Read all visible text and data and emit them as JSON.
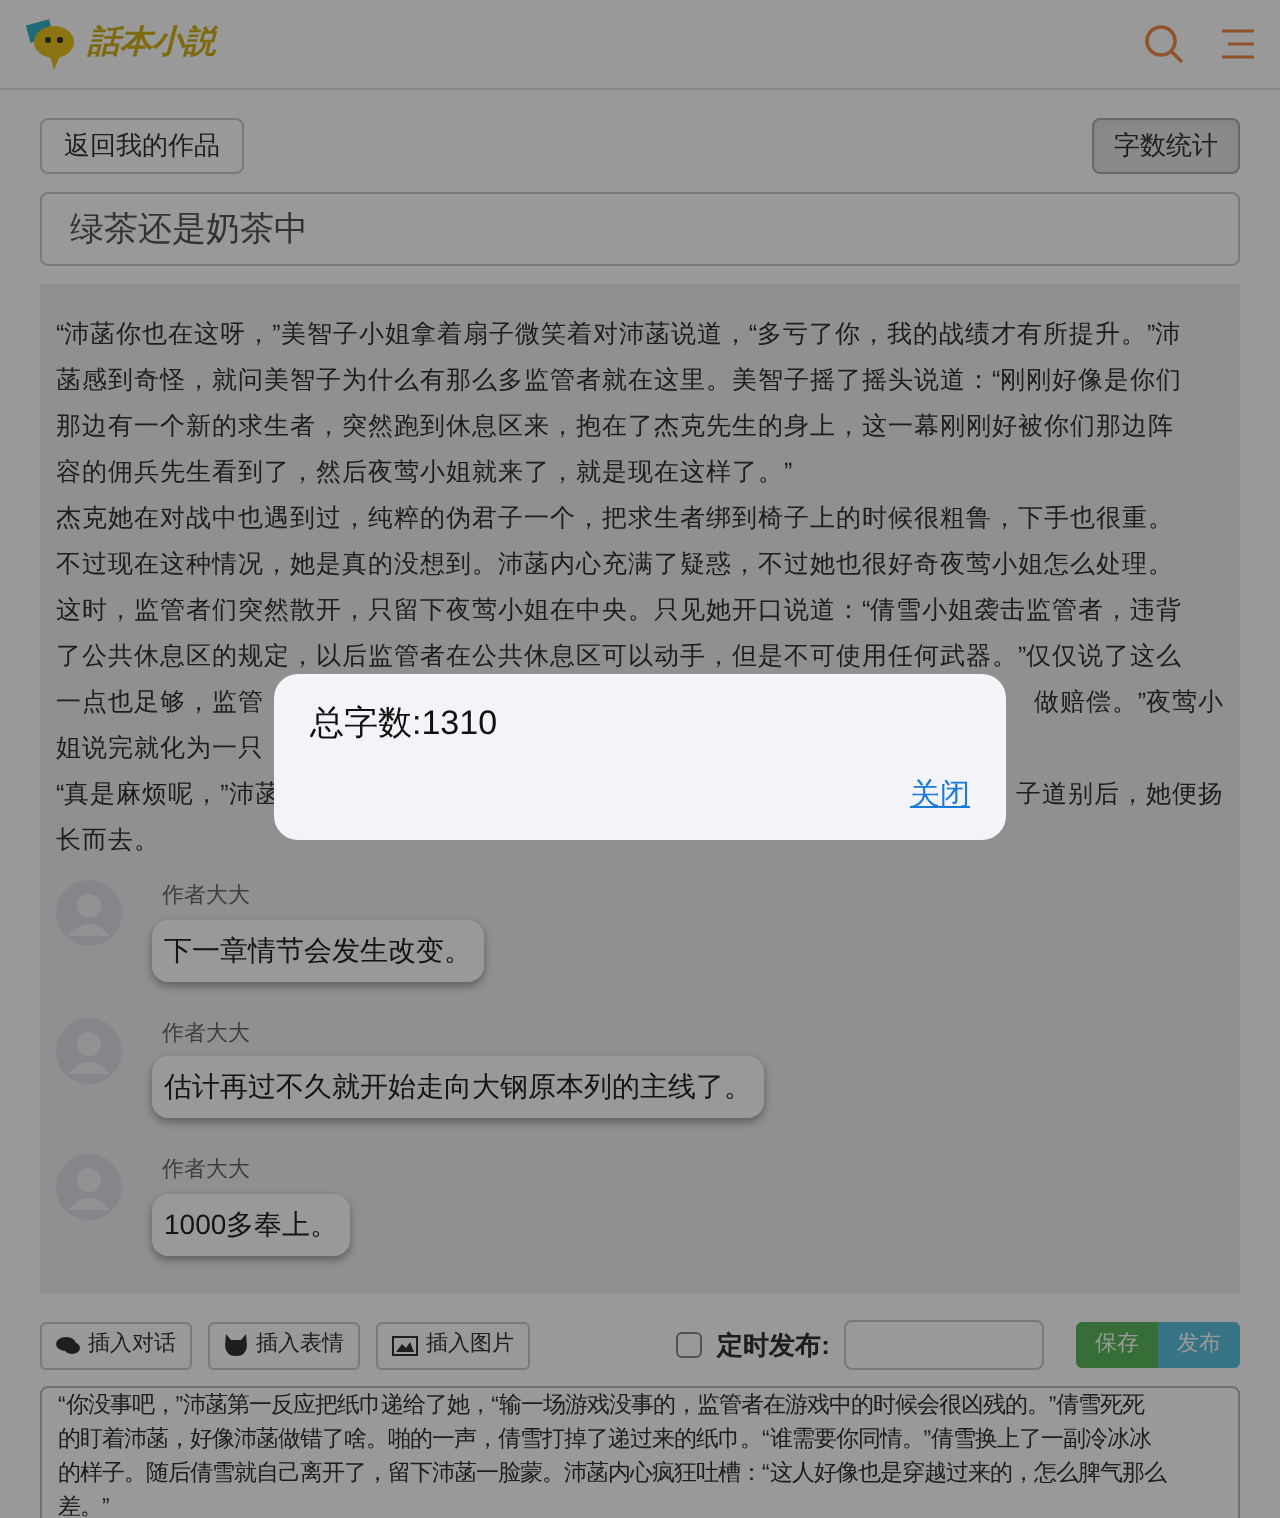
{
  "header": {
    "logo_text": "話本小説"
  },
  "back_button": "返回我的作品",
  "word_count_button": "字数统计",
  "title_field": {
    "value": "绿茶还是奶茶中"
  },
  "story_lines": [
    {
      "left": "“沛菡你也在这呀，”美智子小姐拿着扇子微笑着对沛菡说道，“多亏了你，我的战绩才有所提升。”沛"
    },
    {
      "left": "菡感到奇怪，就问美智子为什么有那么多监管者就在这里。美智子摇了摇头说道：“刚刚好像是你们"
    },
    {
      "left": "那边有一个新的求生者，突然跑到休息区来，抱在了杰克先生的身上，这一幕刚刚好被你们那边阵"
    },
    {
      "left": "容的佣兵先生看到了，然后夜莺小姐就来了，就是现在这样了。”"
    },
    {
      "left": "杰克她在对战中也遇到过，纯粹的伪君子一个，把求生者绑到椅子上的时候很粗鲁，下手也很重。"
    },
    {
      "left": "不过现在这种情况，她是真的没想到。沛菡内心充满了疑惑，不过她也很好奇夜莺小姐怎么处理。"
    },
    {
      "left": "这时，监管者们突然散开，只留下夜莺小姐在中央。只见她开口说道：“倩雪小姐袭击监管者，违背"
    },
    {
      "left": "了公共休息区的规定，以后监管者在公共休息区可以动手，但是不可使用任何武器。”仅仅说了这么"
    },
    {
      "left": "一点也足够，监管",
      "right": "做赔偿。”夜莺小"
    },
    {
      "left": "姐说完就化为一只"
    },
    {
      "left": "“真是麻烦呢，”沛菡",
      "right": "子道别后，她便扬"
    },
    {
      "left": "长而去。"
    }
  ],
  "comments": [
    {
      "author": "作者大大",
      "text": "下一章情节会发生改变。"
    },
    {
      "author": "作者大大",
      "text": "估计再过不久就开始走向大钢原本列的主线了。"
    },
    {
      "author": "作者大大",
      "text": "1000多奉上。"
    }
  ],
  "toolbar": {
    "buttons": [
      {
        "kind": "dialogue",
        "label": "插入对话"
      },
      {
        "kind": "emoji",
        "label": "插入表情"
      },
      {
        "kind": "image",
        "label": "插入图片"
      }
    ],
    "schedule": {
      "checked": false,
      "label": "定时发布:"
    },
    "save": "保存",
    "publish": "发布"
  },
  "editor_lines": [
    "“你没事吧，”沛菡第一反应把纸巾递给了她，“输一场游戏没事的，监管者在游戏中的时候会很凶残的。”倩雪死死",
    "的盯着沛菡，好像沛菡做错了啥。啪的一声，倩雪打掉了递过来的纸巾。“谁需要你同情。”倩雪换上了一副冷冰冰",
    "的样子。随后倩雪就自己离开了，留下沛菡一脸蒙。沛菡内心疯狂吐槽：“这人好像也是穿越过来的，怎么脾气那么",
    "差。”"
  ],
  "dialog": {
    "message": "总字数:1310",
    "close": "关闭"
  }
}
